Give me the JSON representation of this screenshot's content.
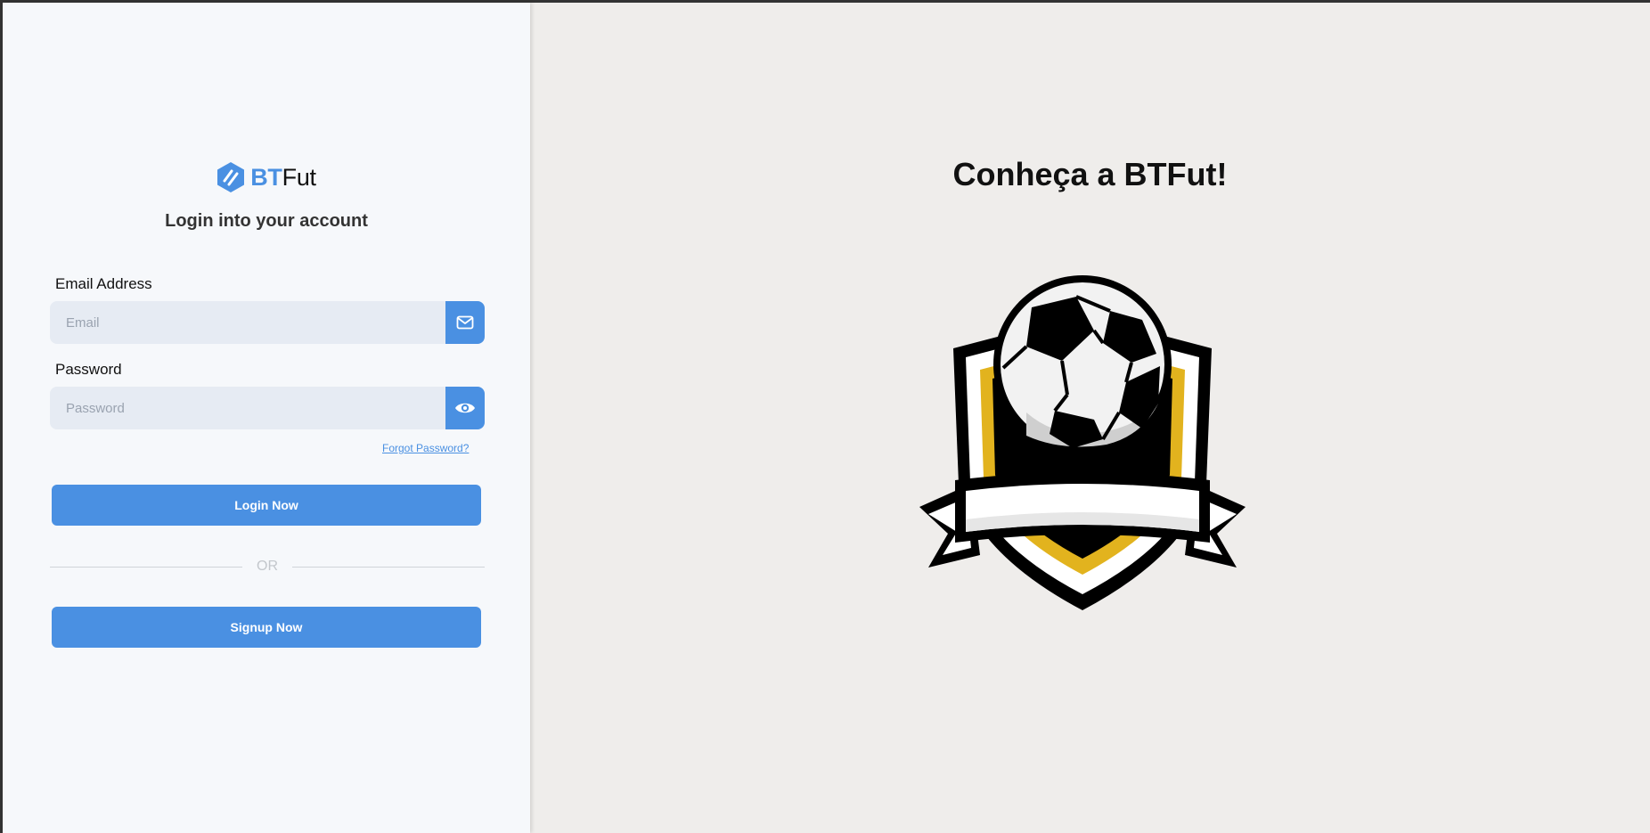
{
  "brand": {
    "name_bold": "BT",
    "name_regular": "Fut",
    "logo_icon": "hexagon-stripes-icon"
  },
  "login": {
    "title": "Login into your account",
    "email": {
      "label": "Email Address",
      "placeholder": "Email",
      "value": "",
      "icon": "mail-icon"
    },
    "password": {
      "label": "Password",
      "placeholder": "Password",
      "value": "",
      "icon": "eye-icon"
    },
    "forgot_password": "Forgot Password?",
    "login_button": "Login Now",
    "or_text": "OR",
    "signup_button": "Signup Now"
  },
  "promo": {
    "title": "Conheça a BTFut!",
    "image_icon": "soccer-crest-icon"
  },
  "colors": {
    "accent": "#4a90e2",
    "left_bg": "#f6f8fb",
    "right_bg": "#efedeb",
    "input_bg": "#e6ebf3",
    "crest_gold": "#e2b31e"
  }
}
